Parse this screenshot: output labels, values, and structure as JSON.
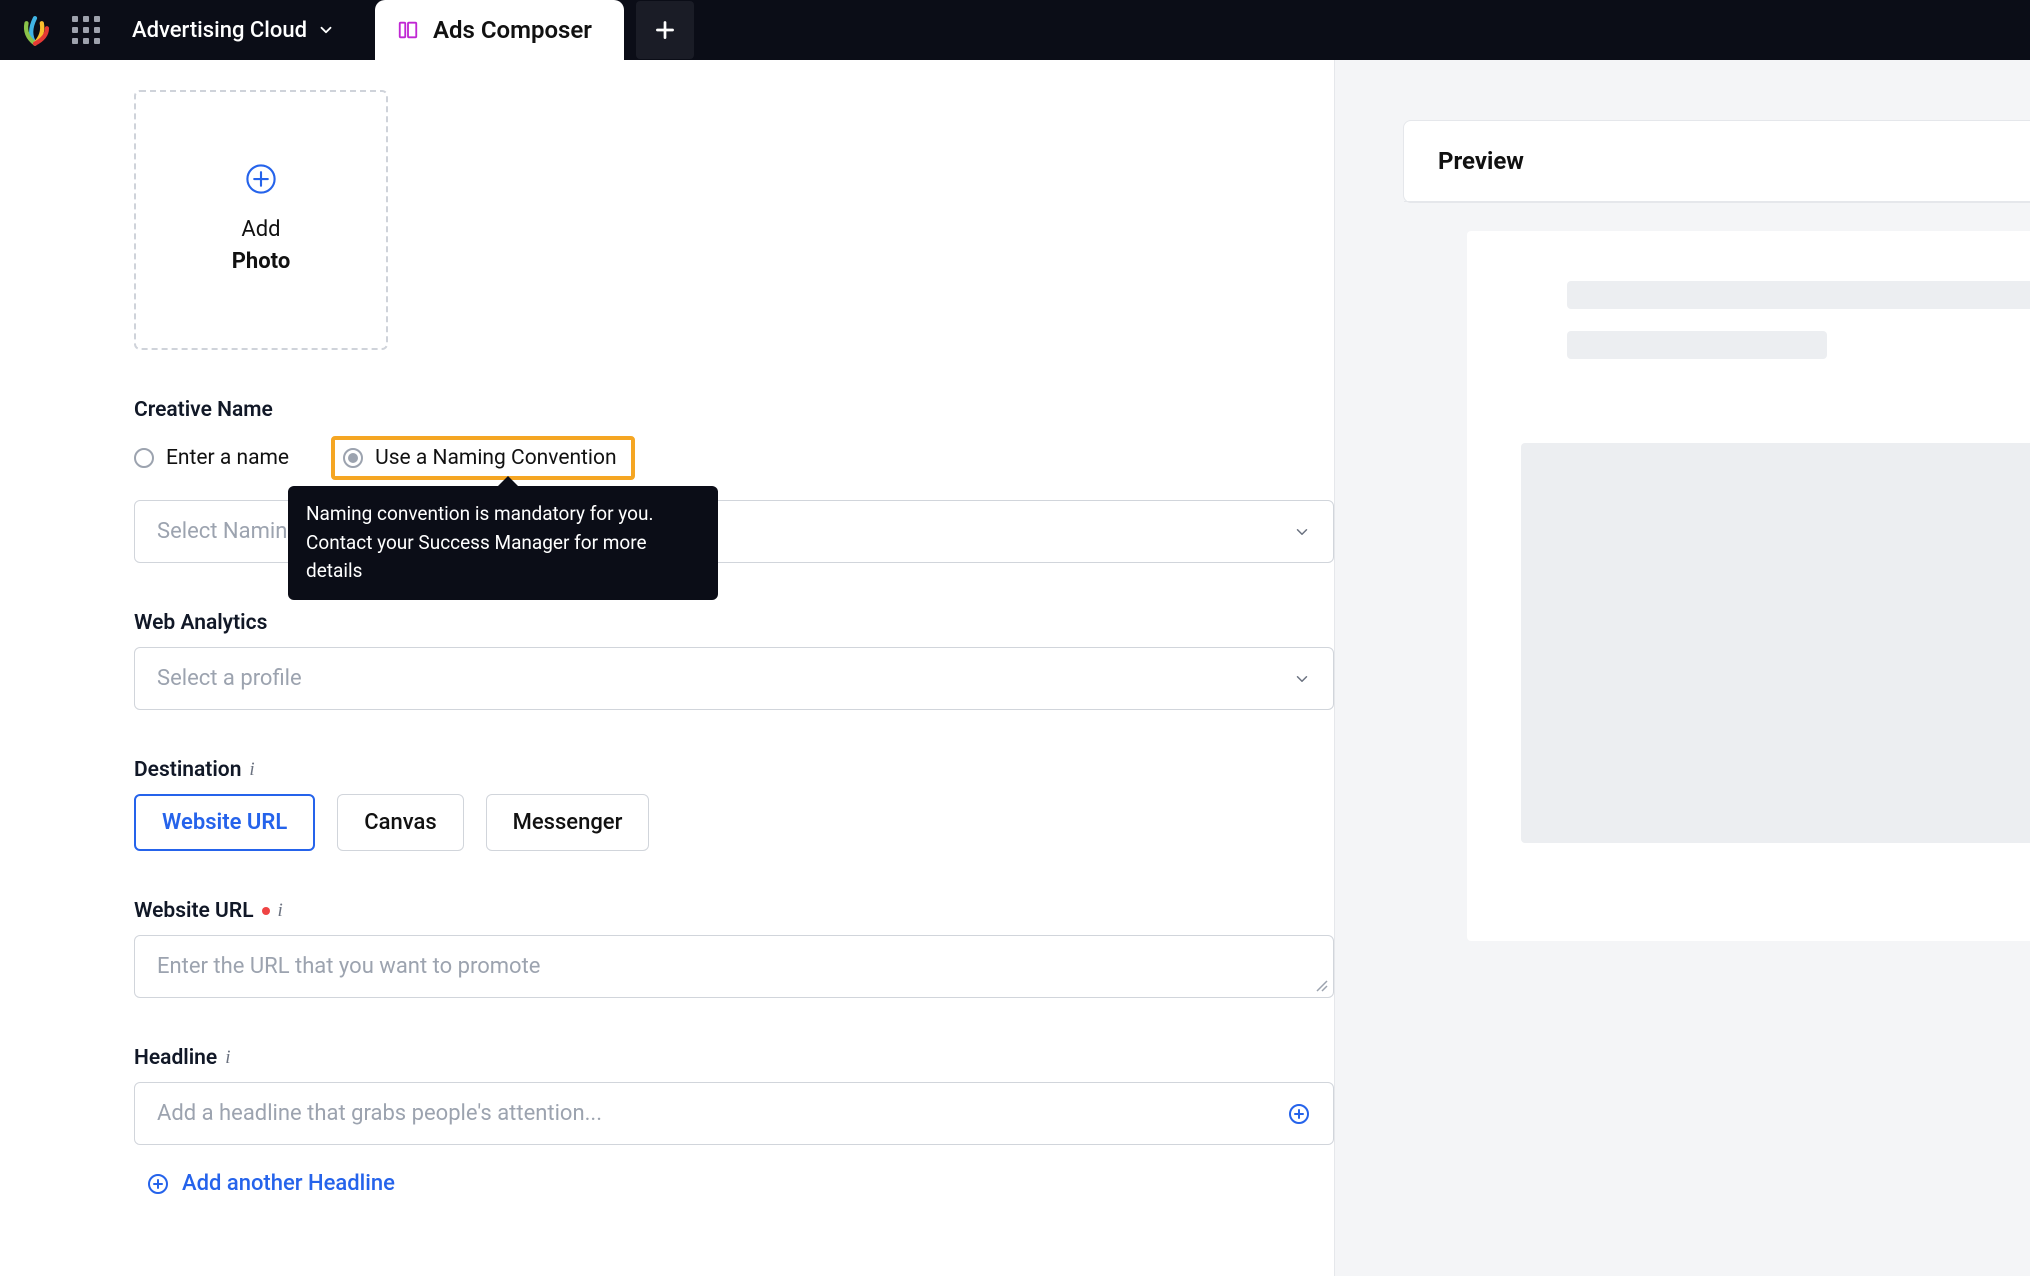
{
  "topbar": {
    "product_name": "Advertising Cloud",
    "active_tab_label": "Ads Composer"
  },
  "form": {
    "add_photo": {
      "line1": "Add",
      "line2": "Photo"
    },
    "creative_name": {
      "label": "Creative Name",
      "option_manual": "Enter a name",
      "option_convention": "Use a Naming Convention",
      "tooltip": "Naming convention is mandatory for you. Contact your Success Manager for more details",
      "select_placeholder": "Select Naming Convention"
    },
    "web_analytics": {
      "label": "Web Analytics",
      "select_placeholder": "Select a profile"
    },
    "destination": {
      "label": "Destination",
      "options": {
        "website": "Website URL",
        "canvas": "Canvas",
        "messenger": "Messenger"
      }
    },
    "website_url": {
      "label": "Website URL",
      "placeholder": "Enter the URL that you want to promote"
    },
    "headline": {
      "label": "Headline",
      "placeholder": "Add a headline that grabs people's attention...",
      "add_another": "Add another Headline"
    }
  },
  "preview": {
    "title": "Preview"
  }
}
